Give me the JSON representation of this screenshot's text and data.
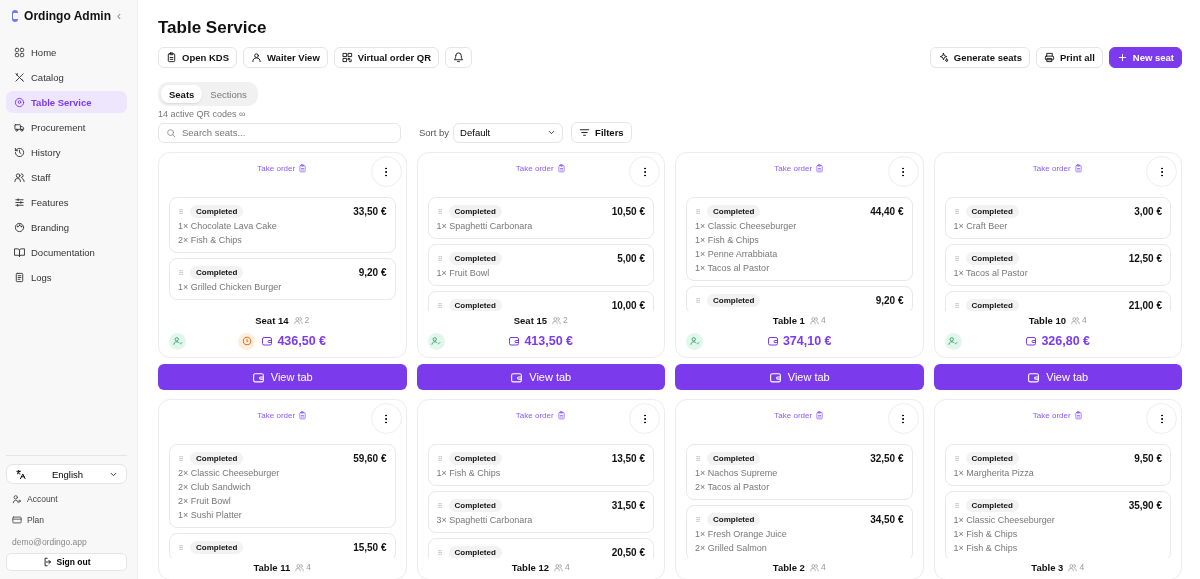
{
  "brand": {
    "name": "Ordingo Admin",
    "collapse": "‹"
  },
  "sidebar": {
    "items": [
      {
        "label": "Home",
        "selected": false
      },
      {
        "label": "Catalog",
        "selected": false
      },
      {
        "label": "Table Service",
        "selected": true
      },
      {
        "label": "Procurement",
        "selected": false
      },
      {
        "label": "History",
        "selected": false
      },
      {
        "label": "Staff",
        "selected": false
      },
      {
        "label": "Features",
        "selected": false
      },
      {
        "label": "Branding",
        "selected": false
      },
      {
        "label": "Documentation",
        "selected": false
      },
      {
        "label": "Logs",
        "selected": false
      }
    ],
    "language": "English",
    "links": [
      "Account",
      "Plan"
    ],
    "email": "demo@ordingo.app",
    "sign_out": "Sign out"
  },
  "page": {
    "title": "Table Service",
    "actions_left": [
      "Open KDS",
      "Waiter View",
      "Virtual order QR"
    ],
    "actions_right": [
      {
        "label": "Generate seats",
        "kind": "outline"
      },
      {
        "label": "Print all",
        "kind": "outline"
      },
      {
        "label": "New seat",
        "kind": "primary"
      }
    ],
    "tabs": [
      {
        "label": "Seats",
        "selected": true
      },
      {
        "label": "Sections",
        "selected": false
      }
    ],
    "qr_info": "14 active QR codes ∞",
    "search": {
      "placeholder": "Search seats..."
    },
    "sort": {
      "label": "Sort by",
      "value": "Default"
    },
    "filters": "Filters"
  },
  "seats": [
    {
      "take_order": "Take order",
      "name": "Seat 14",
      "guests": "2",
      "pending": true,
      "checked_in": true,
      "total": "436,50 €",
      "view": "View tab",
      "orders": [
        {
          "status": "Completed",
          "price": "33,50 €",
          "items": [
            "1× Chocolate Lava Cake",
            "2× Fish & Chips"
          ]
        },
        {
          "status": "Completed",
          "price": "9,20 €",
          "items": [
            "1× Grilled Chicken Burger"
          ]
        }
      ]
    },
    {
      "take_order": "Take order",
      "name": "Seat 15",
      "guests": "2",
      "pending": false,
      "checked_in": true,
      "total": "413,50 €",
      "view": "View tab",
      "orders": [
        {
          "status": "Completed",
          "price": "10,50 €",
          "items": [
            "1× Spaghetti Carbonara"
          ]
        },
        {
          "status": "Completed",
          "price": "5,00 €",
          "items": [
            "1× Fruit Bowl"
          ]
        },
        {
          "status": "Completed",
          "price": "10,00 €"
        }
      ]
    },
    {
      "take_order": "Take order",
      "name": "Table 1",
      "guests": "4",
      "pending": false,
      "checked_in": true,
      "total": "374,10 €",
      "view": "View tab",
      "orders": [
        {
          "status": "Completed",
          "price": "44,40 €",
          "items": [
            "1× Classic Cheeseburger",
            "1× Fish & Chips",
            "1× Penne Arrabbiata",
            "1× Tacos al Pastor"
          ]
        },
        {
          "status": "Completed",
          "price": "9,20 €"
        }
      ]
    },
    {
      "take_order": "Take order",
      "name": "Table 10",
      "guests": "4",
      "pending": false,
      "checked_in": true,
      "total": "326,80 €",
      "view": "View tab",
      "orders": [
        {
          "status": "Completed",
          "price": "3,00 €",
          "items": [
            "1× Craft Beer"
          ]
        },
        {
          "status": "Completed",
          "price": "12,50 €",
          "items": [
            "1× Tacos al Pastor"
          ]
        },
        {
          "status": "Completed",
          "price": "21,00 €"
        }
      ]
    },
    {
      "take_order": "Take order",
      "name": "Table 11",
      "guests": "4",
      "orders": [
        {
          "status": "Completed",
          "price": "59,60 €",
          "items": [
            "2× Classic Cheeseburger",
            "2× Club Sandwich",
            "2× Fruit Bowl",
            "1× Sushi Platter"
          ]
        },
        {
          "status": "Completed",
          "price": "15,50 €"
        }
      ]
    },
    {
      "take_order": "Take order",
      "name": "Table 12",
      "guests": "4",
      "orders": [
        {
          "status": "Completed",
          "price": "13,50 €",
          "items": [
            "1× Fish & Chips"
          ]
        },
        {
          "status": "Completed",
          "price": "31,50 €",
          "items": [
            "3× Spaghetti Carbonara"
          ]
        },
        {
          "status": "Completed",
          "price": "20,50 €"
        }
      ]
    },
    {
      "take_order": "Take order",
      "name": "Table 2",
      "guests": "4",
      "orders": [
        {
          "status": "Completed",
          "price": "32,50 €",
          "items": [
            "1× Nachos Supreme",
            "2× Tacos al Pastor"
          ]
        },
        {
          "status": "Completed",
          "price": "34,50 €",
          "items": [
            "1× Fresh Orange Juice",
            "2× Grilled Salmon"
          ]
        }
      ]
    },
    {
      "take_order": "Take order",
      "name": "Table 3",
      "guests": "4",
      "orders": [
        {
          "status": "Completed",
          "price": "9,50 €",
          "items": [
            "1× Margherita Pizza"
          ]
        },
        {
          "status": "Completed",
          "price": "35,90 €",
          "items": [
            "1× Classic Cheeseburger",
            "1× Fish & Chips",
            "1× Fish & Chips"
          ]
        }
      ]
    }
  ]
}
